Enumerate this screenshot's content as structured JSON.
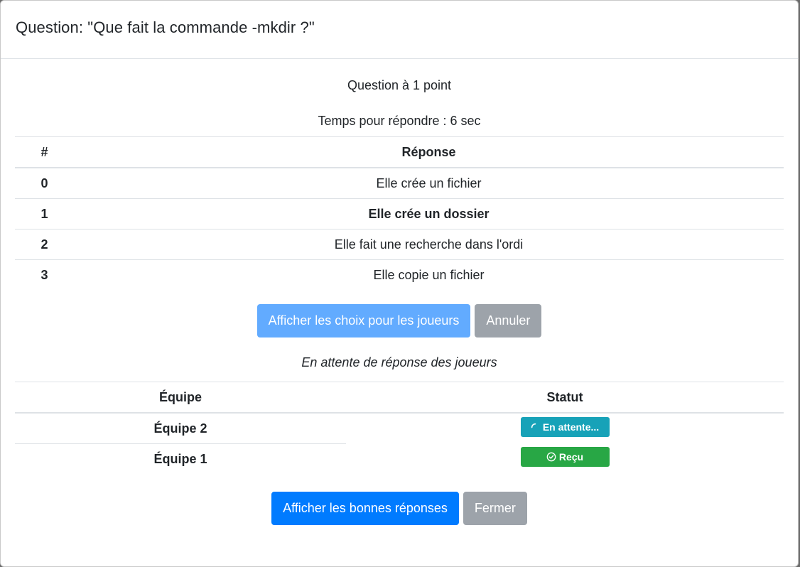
{
  "modal": {
    "title": "Question: \"Que fait la commande -mkdir ?\""
  },
  "question": {
    "points": "Question à 1 point",
    "time": "Temps pour répondre : 6 sec"
  },
  "answers_table": {
    "headers": [
      "#",
      "Réponse"
    ],
    "rows": [
      {
        "num": "0",
        "text": "Elle crée un fichier"
      },
      {
        "num": "1",
        "text": "Elle crée un dossier"
      },
      {
        "num": "2",
        "text": "Elle fait une recherche dans l'ordi"
      },
      {
        "num": "3",
        "text": "Elle copie un fichier"
      }
    ]
  },
  "buttons_top": {
    "show_choices": "Afficher les choix pour les joueurs",
    "cancel": "Annuler"
  },
  "waiting_text": "En attente de réponse des joueurs",
  "teams_table": {
    "headers": [
      "Équipe",
      "Statut"
    ],
    "rows": [
      {
        "team": "Équipe 2",
        "status": "En attente..."
      },
      {
        "team": "Équipe 1",
        "status": "Reçu"
      }
    ]
  },
  "buttons_bottom": {
    "show_answers": "Afficher les bonnes réponses",
    "close": "Fermer"
  },
  "icons": {
    "pending": "spinner-icon",
    "received": "check-circle-icon"
  },
  "colors": {
    "primary": "#007bff",
    "primary_disabled": "#62abff",
    "secondary": "#9da3aa",
    "info": "#17a2b8",
    "success": "#28a745"
  }
}
